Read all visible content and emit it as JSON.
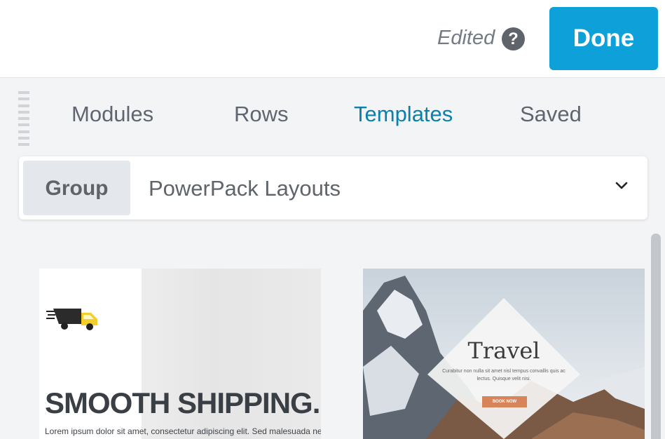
{
  "header": {
    "edited_label": "Edited",
    "help_icon": "question-circle-icon",
    "help_glyph": "?",
    "done_label": "Done",
    "done_color": "#0ea0d8"
  },
  "tabs": [
    {
      "label": "Modules",
      "active": false
    },
    {
      "label": "Rows",
      "active": false
    },
    {
      "label": "Templates",
      "active": true
    },
    {
      "label": "Saved",
      "active": false
    }
  ],
  "group_select": {
    "label": "Group",
    "value": "PowerPack Layouts",
    "icon": "chevron-down-icon"
  },
  "templates": [
    {
      "headline": "SMOOTH SHIPPING.",
      "subtext": "Lorem ipsum dolor sit amet, consectetur adipiscing elit. Sed malesuada neq",
      "icon": "truck-icon"
    },
    {
      "title": "Travel",
      "text": "Curabitur non nulla sit amet nisl tempus convallis quis ac lectus. Quisque velit nisi.",
      "button_label": "BOOK NOW",
      "accent_color": "#d8845a"
    }
  ]
}
